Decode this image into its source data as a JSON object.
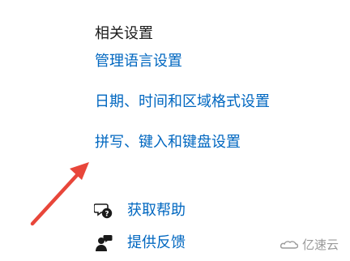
{
  "related_settings": {
    "title": "相关设置",
    "links": [
      {
        "label": "管理语言设置"
      },
      {
        "label": "日期、时间和区域格式设置"
      },
      {
        "label": "拼写、键入和键盘设置"
      }
    ]
  },
  "help": {
    "get_help_label": "获取帮助",
    "feedback_label": "提供反馈"
  },
  "watermark": {
    "text": "亿速云"
  },
  "colors": {
    "link": "#0067c0",
    "annotation_arrow": "#e8463a"
  }
}
